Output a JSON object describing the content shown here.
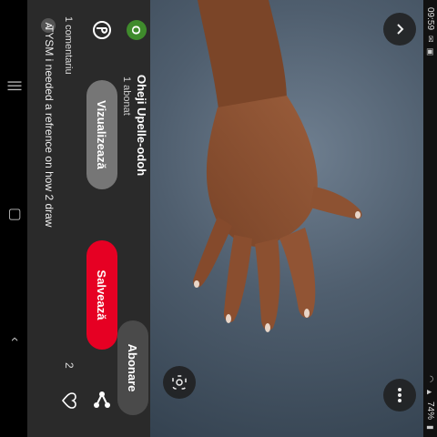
{
  "status_bar": {
    "time": "09:59",
    "battery": "74%",
    "left_icons": [
      "message-icon",
      "image-icon"
    ],
    "right_icons": [
      "wifi-icon",
      "signal-icon"
    ]
  },
  "pin": {
    "creator_name": "Oheji Upelle-odoh",
    "creator_initial": "O",
    "followers": "1 abonat",
    "subscribe_label": "Abonare",
    "view_label": "Vizualizează",
    "save_label": "Salvează",
    "save_count": "2",
    "comments_count": "1 comentariu",
    "commenter_initial": "A",
    "comment_text": "TYSM i needed a refrence on how 2 draw"
  },
  "colors": {
    "save_button": "#e60023",
    "view_button": "#767676",
    "avatar": "#3f8b2c",
    "panel": "#2a2a2a"
  },
  "icons": {
    "up": "chevron-up-icon",
    "more": "more-icon",
    "lens": "lens-icon",
    "pinterest": "pinterest-icon",
    "share": "share-icon",
    "heart": "heart-icon",
    "nav_back": "nav-back-icon",
    "nav_home": "nav-home-icon",
    "nav_recent": "nav-recents-icon"
  }
}
